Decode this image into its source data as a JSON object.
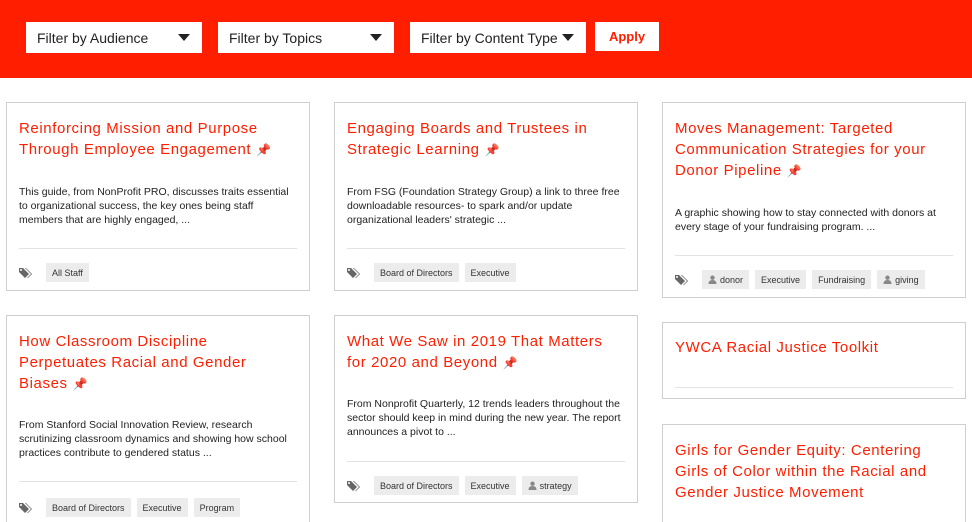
{
  "filters": {
    "audience": "Filter by Audience",
    "topics": "Filter by Topics",
    "content_type": "Filter by Content Type",
    "apply_label": "Apply"
  },
  "colors": {
    "accent": "#ff1e00",
    "tag_bg": "#ececec"
  },
  "icons": {
    "tags": "tags-icon",
    "pin": "pushpin-icon",
    "person": "person-icon",
    "dropdown": "chevron-down-icon"
  },
  "cards": [
    {
      "title": "Reinforcing Mission and Purpose Through Employee Engagement",
      "pinned": true,
      "description": "This guide, from NonProfit PRO, discusses traits essential to organizational success, the key ones being staff members that are highly engaged, ...",
      "tags": [
        {
          "label": "All Staff"
        }
      ]
    },
    {
      "title": "Engaging Boards and Trustees in Strategic Learning",
      "pinned": true,
      "description": "From FSG (Foundation Strategy Group) a link to three free downloadable resources- to spark and/or update organizational leaders' strategic ...",
      "tags": [
        {
          "label": "Board of Directors"
        },
        {
          "label": "Executive"
        }
      ]
    },
    {
      "title": "Moves Management: Targeted Communication Strategies for your Donor Pipeline",
      "pinned": true,
      "description": "A graphic showing how to stay connected with donors at every stage of your fundraising program. ...",
      "tags": [
        {
          "label": "donor",
          "person": true
        },
        {
          "label": "Executive"
        },
        {
          "label": "Fundraising"
        },
        {
          "label": "giving",
          "person": true
        }
      ]
    },
    {
      "title": "How Classroom Discipline Perpetuates Racial and Gender Biases",
      "pinned": true,
      "description": "From Stanford Social Innovation Review, research scrutinizing classroom dynamics and showing how school practices contribute to gendered status ...",
      "tags": [
        {
          "label": "Board of Directors"
        },
        {
          "label": "Executive"
        },
        {
          "label": "Program"
        }
      ]
    },
    {
      "title": "What We Saw in 2019 That Matters for 2020 and Beyond",
      "pinned": true,
      "description": "From Nonprofit Quarterly, 12 trends leaders throughout the sector should keep in mind during the new year. The report announces a pivot to ...",
      "tags": [
        {
          "label": "Board of Directors"
        },
        {
          "label": "Executive"
        },
        {
          "label": "strategy",
          "person": true
        }
      ]
    },
    {
      "title": "YWCA Racial Justice Toolkit",
      "pinned": false
    },
    {
      "title": "Girls for Gender Equity: Centering Girls of Color within the Racial and Gender Justice Movement",
      "pinned": false
    }
  ]
}
